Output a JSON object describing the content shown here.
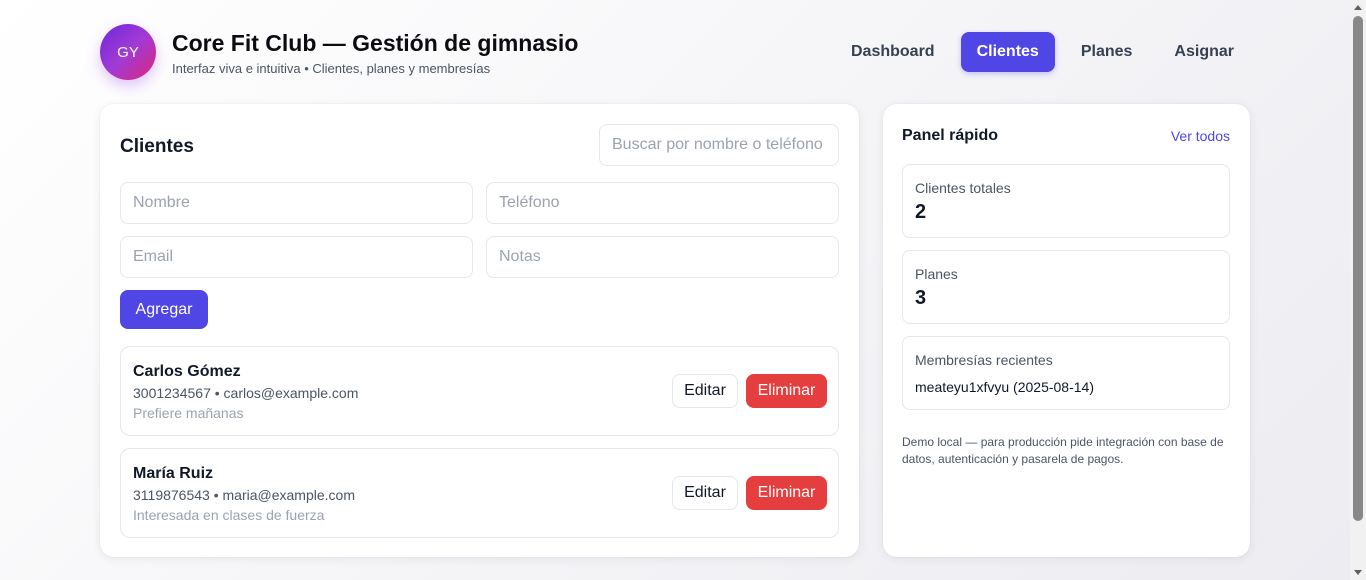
{
  "header": {
    "avatar_initials": "GY",
    "title": "Core Fit Club — Gestión de gimnasio",
    "subtitle": "Interfaz viva e intuitiva • Clientes, planes y membresías"
  },
  "nav": [
    {
      "label": "Dashboard",
      "active": false
    },
    {
      "label": "Clientes",
      "active": true
    },
    {
      "label": "Planes",
      "active": false
    },
    {
      "label": "Asignar",
      "active": false
    }
  ],
  "clients_panel": {
    "title": "Clientes",
    "search": {
      "placeholder": "Buscar por nombre o teléfono",
      "value": ""
    },
    "form": {
      "name_placeholder": "Nombre",
      "phone_placeholder": "Teléfono",
      "email_placeholder": "Email",
      "notes_placeholder": "Notas",
      "add_label": "Agregar"
    },
    "clients": [
      {
        "name": "Carlos Gómez",
        "contact": "3001234567 • carlos@example.com",
        "notes": "Prefiere mañanas",
        "edit_label": "Editar",
        "delete_label": "Eliminar"
      },
      {
        "name": "María Ruiz",
        "contact": "3119876543 • maria@example.com",
        "notes": "Interesada en clases de fuerza",
        "edit_label": "Editar",
        "delete_label": "Eliminar"
      }
    ]
  },
  "quick_panel": {
    "title": "Panel rápido",
    "see_all_label": "Ver todos",
    "total_clients_label": "Clientes totales",
    "total_clients_value": "2",
    "plans_label": "Planes",
    "plans_value": "3",
    "recent_memberships_label": "Membresías recientes",
    "recent_memberships_item": "meateyu1xfvyu (2025-08-14)",
    "disclaimer": "Demo local — para producción pide integración con base de datos, autenticación y pasarela de pagos."
  },
  "colors": {
    "accent": "#4f46e5",
    "danger": "#e53e3e",
    "avatar_gradient_start": "#6d28d9",
    "avatar_gradient_end": "#db2777"
  },
  "icons": {
    "scroll_up": "triangle-up-icon",
    "scroll_down": "triangle-down-icon"
  }
}
